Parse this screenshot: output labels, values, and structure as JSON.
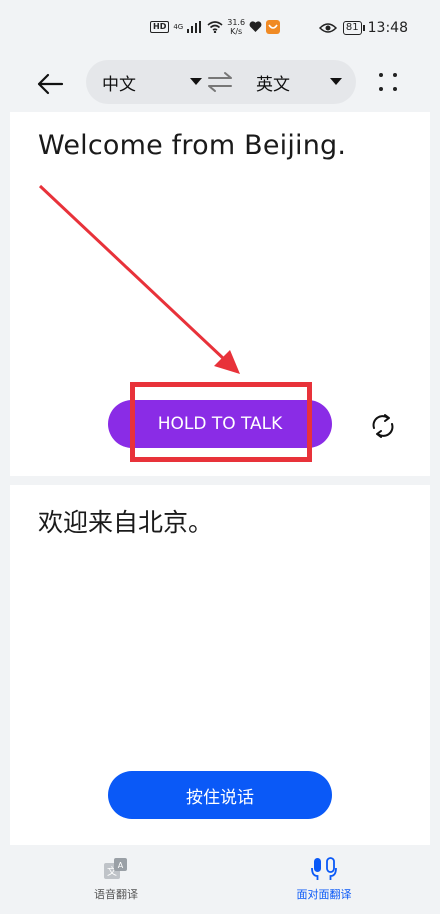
{
  "status_bar": {
    "hd": "HD",
    "signal": "4G",
    "net_speed_value": "31.6",
    "net_speed_unit": "K/s",
    "battery": "81",
    "time": "13:48"
  },
  "toolbar": {
    "source_language": "中文",
    "target_language": "英文"
  },
  "top_panel": {
    "text": "Welcome from Beijing.",
    "hold_button_label": "HOLD TO TALK"
  },
  "bottom_panel": {
    "text": "欢迎来自北京。",
    "talk_button_label": "按住说话"
  },
  "bottom_nav": {
    "items": [
      {
        "label": "语音翻译",
        "active": false
      },
      {
        "label": "面对面翻译",
        "active": true
      }
    ]
  },
  "colors": {
    "hold_button": "#8a2ce6",
    "talk_button": "#0a59f7",
    "active_nav": "#0a59f7",
    "annotation": "#e8323a",
    "panel_background": "#ffffff",
    "page_background": "#f1f3f5"
  },
  "icons": {
    "back": "arrow-left-icon",
    "swap": "swap-arrows-icon",
    "more": "four-dots-icon",
    "refresh": "rotate-icon",
    "voice_translate": "translate-icon",
    "face_to_face": "dual-mic-icon"
  }
}
